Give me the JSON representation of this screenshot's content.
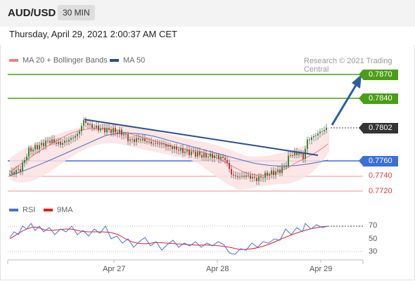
{
  "header": {
    "symbol": "AUD/USD",
    "timeframe": "30 MIN"
  },
  "timestamp": "Thursday, April 29, 2021 2:00:37 AM CET",
  "legend": {
    "ma20": {
      "label": "MA 20 + Bollinger Bands",
      "color": "#f08080"
    },
    "ma50": {
      "label": "MA 50",
      "color": "#2b4f8c"
    }
  },
  "credit": "Research © 2021 Trading Central",
  "levels": {
    "r2": "0.7870",
    "r1": "0.7840",
    "current": "0.7802",
    "pivot": "0.7760",
    "s1": "0.7740",
    "s2": "0.7720"
  },
  "rsi_legend": {
    "rsi": {
      "label": "RSI",
      "color": "#4a6fd8"
    },
    "ma": {
      "label": "9MA",
      "color": "#e02020"
    }
  },
  "rsi_levels": [
    "70",
    "50",
    "30"
  ],
  "x_labels": [
    "Apr 27",
    "Apr 28",
    "Apr 29"
  ],
  "colors": {
    "green": "#4a9e16",
    "blue": "#3b6fd8",
    "dark": "#333333",
    "red": "#e23b3b",
    "arrow": "#2b5f9e"
  }
}
